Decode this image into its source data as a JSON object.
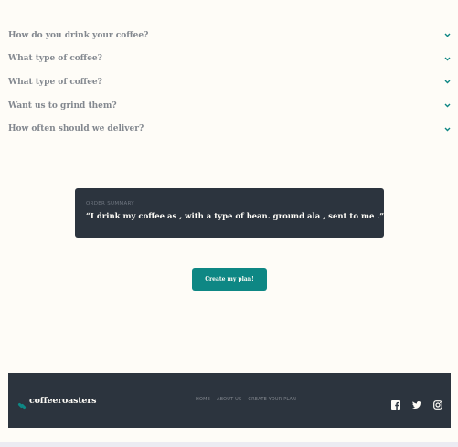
{
  "accordion": {
    "items": [
      {
        "question": "How do you drink your coffee?"
      },
      {
        "question": "What type of coffee?"
      },
      {
        "question": "What type of coffee?"
      },
      {
        "question": "Want us to grind them?"
      },
      {
        "question": "How often should we deliver?"
      }
    ],
    "icon": "chevron-down-icon",
    "chevron_color": "#0e8784"
  },
  "summary": {
    "title": "ORDER SUMMARY",
    "text": "“I drink my coffee as , with a type of bean. ground ala , sent to me .”"
  },
  "cta": {
    "label": "Create my plan!"
  },
  "footer": {
    "brand": "coffeeroasters",
    "nav": [
      "HOME",
      "ABOUT US",
      "CREATE YOUR PLAN"
    ],
    "social_icons": [
      "facebook-icon",
      "twitter-icon",
      "instagram-icon"
    ]
  },
  "colors": {
    "background": "#fefcf7",
    "dark": "#2c343e",
    "accent": "#0e8784",
    "muted": "#83888f"
  }
}
